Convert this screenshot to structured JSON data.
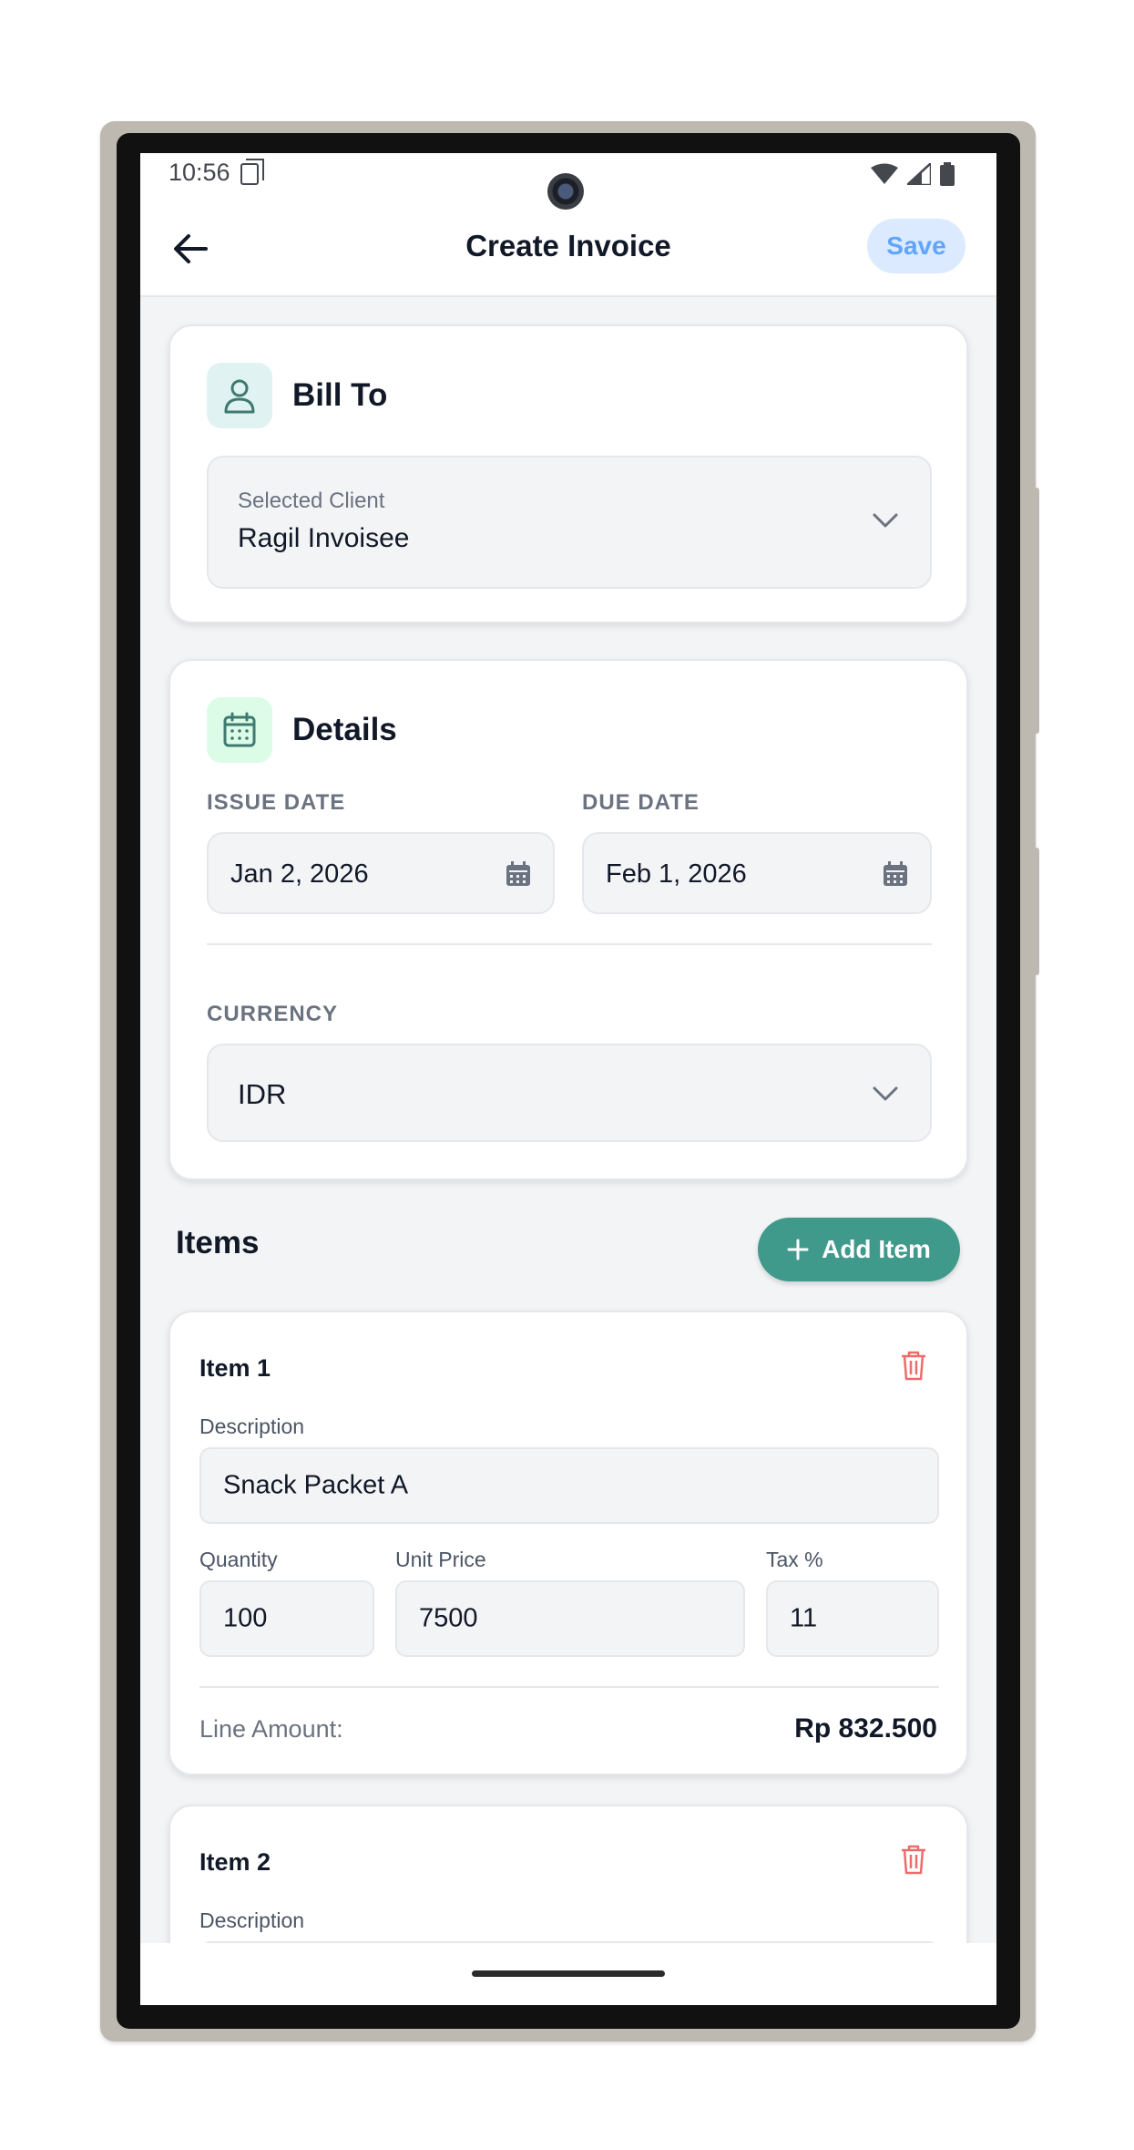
{
  "status_bar": {
    "time": "10:56"
  },
  "app_bar": {
    "title": "Create Invoice",
    "save_label": "Save"
  },
  "bill_to": {
    "title": "Bill To",
    "client_caption": "Selected Client",
    "client_value": "Ragil Invoisee"
  },
  "details": {
    "title": "Details",
    "issue_date_label": "ISSUE DATE",
    "issue_date_value": "Jan 2, 2026",
    "due_date_label": "DUE DATE",
    "due_date_value": "Feb 1, 2026",
    "currency_label": "CURRENCY",
    "currency_value": "IDR"
  },
  "items_section": {
    "title": "Items",
    "add_label": "Add Item"
  },
  "items": [
    {
      "title": "Item 1",
      "description_label": "Description",
      "description_value": "Snack Packet A",
      "quantity_label": "Quantity",
      "quantity_value": "100",
      "unit_price_label": "Unit Price",
      "unit_price_value": "7500",
      "tax_label": "Tax %",
      "tax_value": "11",
      "line_amount_label": "Line Amount:",
      "line_amount_value": "Rp 832.500"
    },
    {
      "title": "Item 2",
      "description_label": "Description",
      "description_value": ""
    }
  ],
  "colors": {
    "accent": "#3f9a8c",
    "save_bg": "#dbeafe",
    "save_text": "#60a5fa",
    "delete": "#ef6b6b"
  },
  "icons": [
    "back-arrow-icon",
    "person-icon",
    "calendar-icon",
    "chevron-down-icon",
    "plus-icon",
    "trash-icon"
  ]
}
